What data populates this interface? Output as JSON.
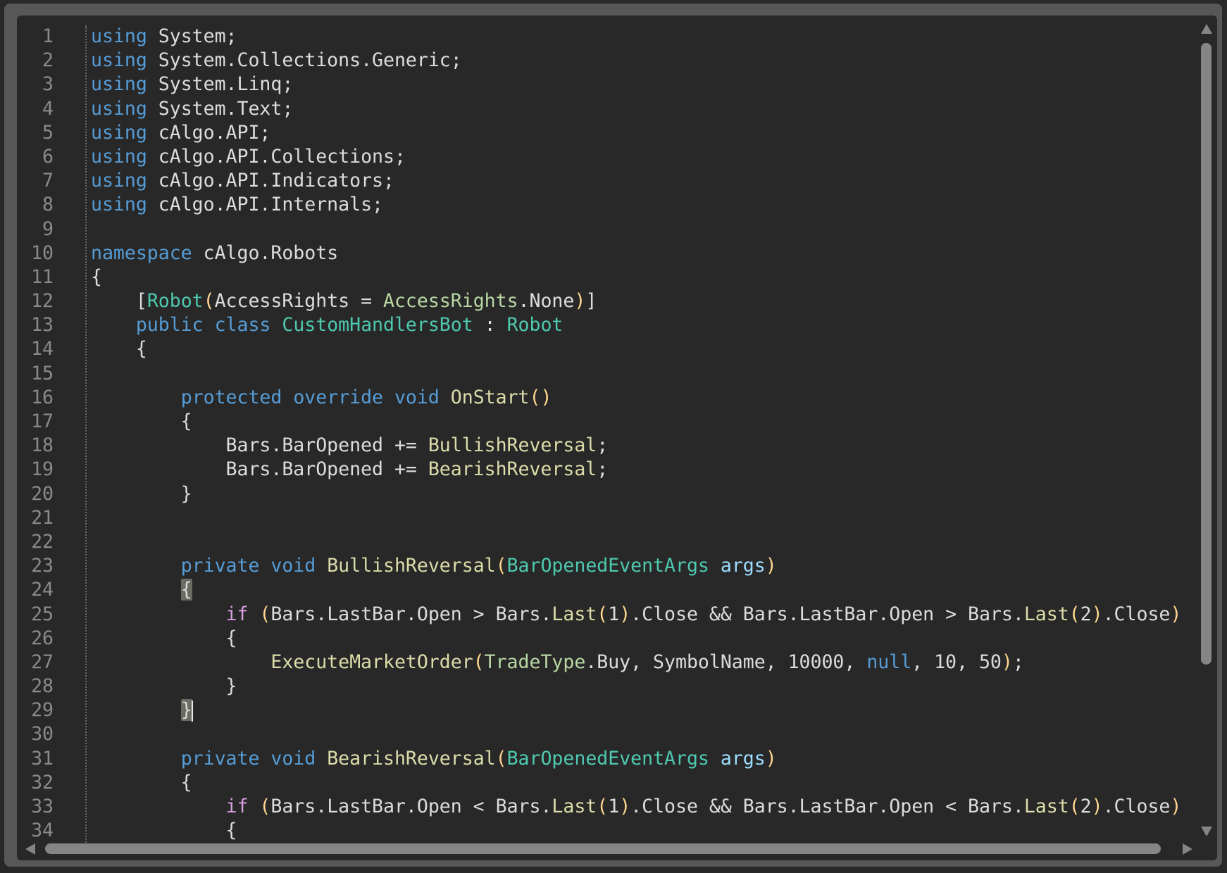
{
  "editor": {
    "language": "C#",
    "lines": [
      {
        "n": "1",
        "tokens": [
          [
            "kw",
            "using"
          ],
          [
            "pl",
            " System;"
          ]
        ]
      },
      {
        "n": "2",
        "tokens": [
          [
            "kw",
            "using"
          ],
          [
            "pl",
            " System.Collections.Generic;"
          ]
        ]
      },
      {
        "n": "3",
        "tokens": [
          [
            "kw",
            "using"
          ],
          [
            "pl",
            " System.Linq;"
          ]
        ]
      },
      {
        "n": "4",
        "tokens": [
          [
            "kw",
            "using"
          ],
          [
            "pl",
            " System.Text;"
          ]
        ]
      },
      {
        "n": "5",
        "tokens": [
          [
            "kw",
            "using"
          ],
          [
            "pl",
            " cAlgo.API;"
          ]
        ]
      },
      {
        "n": "6",
        "tokens": [
          [
            "kw",
            "using"
          ],
          [
            "pl",
            " cAlgo.API.Collections;"
          ]
        ]
      },
      {
        "n": "7",
        "tokens": [
          [
            "kw",
            "using"
          ],
          [
            "pl",
            " cAlgo.API.Indicators;"
          ]
        ]
      },
      {
        "n": "8",
        "tokens": [
          [
            "kw",
            "using"
          ],
          [
            "pl",
            " cAlgo.API.Internals;"
          ]
        ]
      },
      {
        "n": "9",
        "tokens": []
      },
      {
        "n": "10",
        "tokens": [
          [
            "kw",
            "namespace"
          ],
          [
            "pl",
            " cAlgo.Robots"
          ]
        ]
      },
      {
        "n": "11",
        "tokens": [
          [
            "pl",
            "{"
          ]
        ]
      },
      {
        "n": "12",
        "tokens": [
          [
            "pl",
            "    ["
          ],
          [
            "typ",
            "Robot"
          ],
          [
            "brk",
            "("
          ],
          [
            "pl",
            "AccessRights = "
          ],
          [
            "enm",
            "AccessRights"
          ],
          [
            "pl",
            ".None"
          ],
          [
            "brk",
            ")"
          ],
          [
            "pl",
            "]"
          ]
        ]
      },
      {
        "n": "13",
        "tokens": [
          [
            "pl",
            "    "
          ],
          [
            "kw",
            "public"
          ],
          [
            "pl",
            " "
          ],
          [
            "kw",
            "class"
          ],
          [
            "pl",
            " "
          ],
          [
            "typ",
            "CustomHandlersBot"
          ],
          [
            "pl",
            " : "
          ],
          [
            "typ",
            "Robot"
          ]
        ]
      },
      {
        "n": "14",
        "tokens": [
          [
            "pl",
            "    {"
          ]
        ]
      },
      {
        "n": "15",
        "tokens": []
      },
      {
        "n": "16",
        "tokens": [
          [
            "pl",
            "        "
          ],
          [
            "kw",
            "protected"
          ],
          [
            "pl",
            " "
          ],
          [
            "kw",
            "override"
          ],
          [
            "pl",
            " "
          ],
          [
            "kw",
            "void"
          ],
          [
            "pl",
            " "
          ],
          [
            "fn",
            "OnStart"
          ],
          [
            "brk",
            "()"
          ]
        ]
      },
      {
        "n": "17",
        "tokens": [
          [
            "pl",
            "        {"
          ]
        ]
      },
      {
        "n": "18",
        "tokens": [
          [
            "pl",
            "            Bars.BarOpened += "
          ],
          [
            "fn",
            "BullishReversal"
          ],
          [
            "pl",
            ";"
          ]
        ]
      },
      {
        "n": "19",
        "tokens": [
          [
            "pl",
            "            Bars.BarOpened += "
          ],
          [
            "fn",
            "BearishReversal"
          ],
          [
            "pl",
            ";"
          ]
        ]
      },
      {
        "n": "20",
        "tokens": [
          [
            "pl",
            "        }"
          ]
        ]
      },
      {
        "n": "21",
        "tokens": []
      },
      {
        "n": "22",
        "tokens": []
      },
      {
        "n": "23",
        "tokens": [
          [
            "pl",
            "        "
          ],
          [
            "kw",
            "private"
          ],
          [
            "pl",
            " "
          ],
          [
            "kw",
            "void"
          ],
          [
            "pl",
            " "
          ],
          [
            "fn",
            "BullishReversal"
          ],
          [
            "brk",
            "("
          ],
          [
            "typ",
            "BarOpenedEventArgs"
          ],
          [
            "pl",
            " "
          ],
          [
            "prm",
            "args"
          ],
          [
            "brk",
            ")"
          ]
        ]
      },
      {
        "n": "24",
        "tokens": [
          [
            "pl",
            "        "
          ],
          [
            "match",
            "{"
          ]
        ]
      },
      {
        "n": "25",
        "tokens": [
          [
            "pl",
            "            "
          ],
          [
            "ctl",
            "if"
          ],
          [
            "pl",
            " "
          ],
          [
            "brk",
            "("
          ],
          [
            "pl",
            "Bars.LastBar.Open > Bars."
          ],
          [
            "fn",
            "Last"
          ],
          [
            "brk",
            "("
          ],
          [
            "num",
            "1"
          ],
          [
            "brk",
            ")"
          ],
          [
            "pl",
            ".Close && Bars.LastBar.Open > Bars."
          ],
          [
            "fn",
            "Last"
          ],
          [
            "brk",
            "("
          ],
          [
            "num",
            "2"
          ],
          [
            "brk",
            ")"
          ],
          [
            "pl",
            ".Close"
          ],
          [
            "brk",
            ")"
          ]
        ]
      },
      {
        "n": "26",
        "tokens": [
          [
            "pl",
            "            {"
          ]
        ]
      },
      {
        "n": "27",
        "tokens": [
          [
            "pl",
            "                "
          ],
          [
            "fn",
            "ExecuteMarketOrder"
          ],
          [
            "brk",
            "("
          ],
          [
            "enm",
            "TradeType"
          ],
          [
            "pl",
            ".Buy, SymbolName, "
          ],
          [
            "num",
            "10000"
          ],
          [
            "pl",
            ", "
          ],
          [
            "kw",
            "null"
          ],
          [
            "pl",
            ", "
          ],
          [
            "num",
            "10"
          ],
          [
            "pl",
            ", "
          ],
          [
            "num",
            "50"
          ],
          [
            "brk",
            ")"
          ],
          [
            "pl",
            ";"
          ]
        ]
      },
      {
        "n": "28",
        "tokens": [
          [
            "pl",
            "            }"
          ]
        ]
      },
      {
        "n": "29",
        "tokens": [
          [
            "pl",
            "        "
          ],
          [
            "match",
            "}"
          ],
          [
            "caret",
            ""
          ]
        ]
      },
      {
        "n": "30",
        "tokens": []
      },
      {
        "n": "31",
        "tokens": [
          [
            "pl",
            "        "
          ],
          [
            "kw",
            "private"
          ],
          [
            "pl",
            " "
          ],
          [
            "kw",
            "void"
          ],
          [
            "pl",
            " "
          ],
          [
            "fn",
            "BearishReversal"
          ],
          [
            "brk",
            "("
          ],
          [
            "typ",
            "BarOpenedEventArgs"
          ],
          [
            "pl",
            " "
          ],
          [
            "prm",
            "args"
          ],
          [
            "brk",
            ")"
          ]
        ]
      },
      {
        "n": "32",
        "tokens": [
          [
            "pl",
            "        {"
          ]
        ]
      },
      {
        "n": "33",
        "tokens": [
          [
            "pl",
            "            "
          ],
          [
            "ctl",
            "if"
          ],
          [
            "pl",
            " "
          ],
          [
            "brk",
            "("
          ],
          [
            "pl",
            "Bars.LastBar.Open < Bars."
          ],
          [
            "fn",
            "Last"
          ],
          [
            "brk",
            "("
          ],
          [
            "num",
            "1"
          ],
          [
            "brk",
            ")"
          ],
          [
            "pl",
            ".Close && Bars.LastBar.Open < Bars."
          ],
          [
            "fn",
            "Last"
          ],
          [
            "brk",
            "("
          ],
          [
            "num",
            "2"
          ],
          [
            "brk",
            ")"
          ],
          [
            "pl",
            ".Close"
          ],
          [
            "brk",
            ")"
          ]
        ]
      },
      {
        "n": "34",
        "tokens": [
          [
            "pl",
            "            {"
          ]
        ]
      }
    ]
  },
  "scrollbars": {
    "vertical": {
      "up_icon": "arrow-up-icon",
      "down_icon": "arrow-down-icon"
    },
    "horizontal": {
      "left_icon": "arrow-left-icon",
      "right_icon": "arrow-right-icon"
    }
  },
  "colors": {
    "background": "#282828",
    "frame": "#575757",
    "keyword": "#569cd6",
    "control": "#d8a0df",
    "type": "#4ec9b0",
    "enum": "#b8d7a3",
    "method": "#dcdcaa",
    "parameter": "#9cdcfe",
    "text": "#dcdcdc",
    "line_number": "#8a8a8a"
  }
}
